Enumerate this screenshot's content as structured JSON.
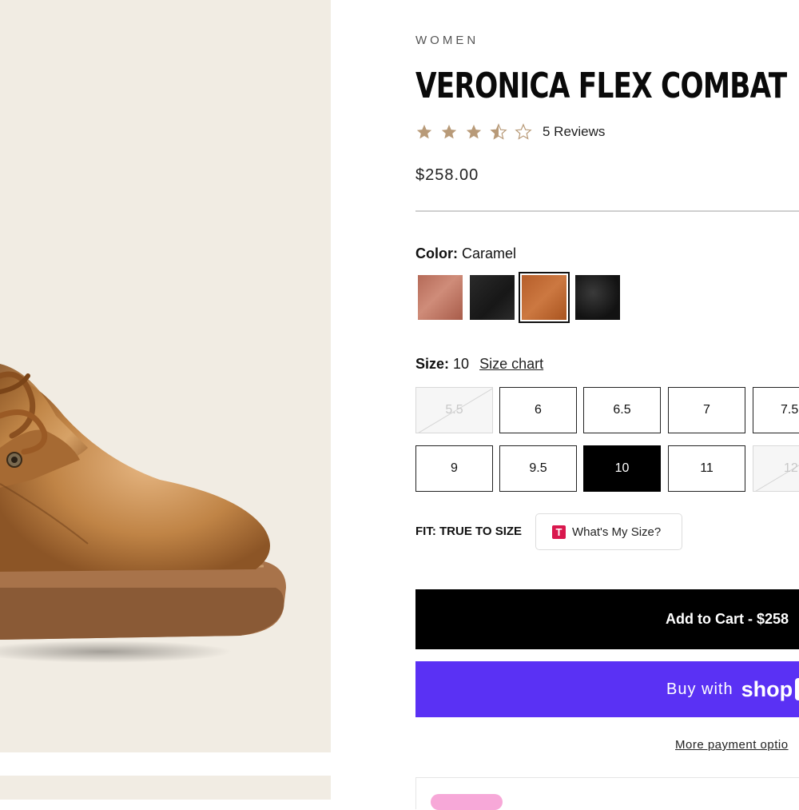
{
  "product": {
    "category": "WOMEN",
    "title": "VERONICA FLEX COMBAT",
    "rating": 3.5,
    "rating_max": 5,
    "reviews_label": "5 Reviews",
    "price": "$258.00"
  },
  "color": {
    "label": "Color:",
    "selected": "Caramel",
    "swatches": [
      {
        "name": "rose-leather",
        "hex": "#c07a66"
      },
      {
        "name": "black-leather",
        "hex": "#1f1f1f"
      },
      {
        "name": "caramel-leather",
        "hex": "#c06a34"
      },
      {
        "name": "black-distressed",
        "hex": "#161616"
      }
    ]
  },
  "size": {
    "label": "Size:",
    "selected": "10",
    "chart_link": "Size chart",
    "row1": [
      "5.5",
      "6",
      "6.5",
      "7",
      "7.5"
    ],
    "row2": [
      "9",
      "9.5",
      "10",
      "11",
      "12"
    ]
  },
  "fit": {
    "label": "FIT: TRUE TO SIZE",
    "whats_my_size": "What's My Size?",
    "badge": "T"
  },
  "actions": {
    "add_to_cart": "Add to Cart - $258",
    "buy_with": "Buy with",
    "shop": "shop",
    "more_payment": "More payment optio"
  },
  "colors": {
    "background_panel": "#f1ece3",
    "shop_purple": "#5a31f4",
    "star": "#b89a78"
  }
}
